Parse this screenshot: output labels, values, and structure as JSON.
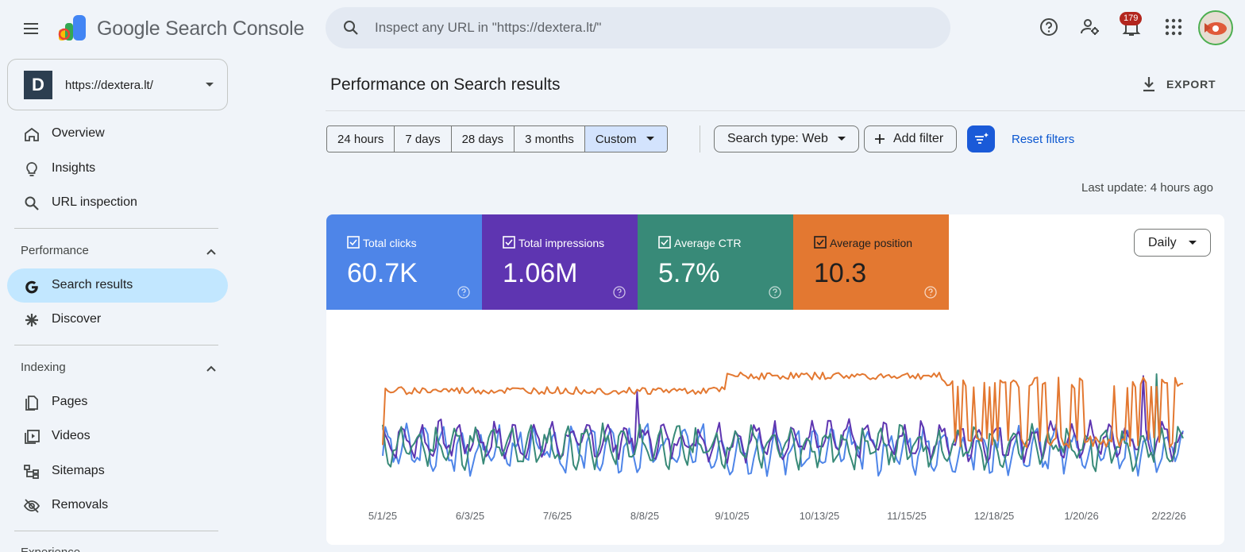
{
  "app": {
    "title": "Google Search Console",
    "notifications_count": "179"
  },
  "search": {
    "placeholder": "Inspect any URL in \"https://dextera.lt/\""
  },
  "property": {
    "logo_letter": "D",
    "name": "https://dextera.lt/"
  },
  "sidebar": {
    "top_items": [
      {
        "label": "Overview",
        "icon": "home-icon"
      },
      {
        "label": "Insights",
        "icon": "lightbulb-icon"
      },
      {
        "label": "URL inspection",
        "icon": "search-icon"
      }
    ],
    "performance": {
      "title": "Performance",
      "items": [
        {
          "label": "Search results",
          "icon": "google-g-icon",
          "active": true
        },
        {
          "label": "Discover",
          "icon": "asterisk-icon"
        }
      ]
    },
    "indexing": {
      "title": "Indexing",
      "items": [
        {
          "label": "Pages",
          "icon": "pages-icon"
        },
        {
          "label": "Videos",
          "icon": "video-icon"
        },
        {
          "label": "Sitemaps",
          "icon": "sitemap-icon"
        },
        {
          "label": "Removals",
          "icon": "eye-off-icon"
        }
      ]
    },
    "next_section_partial": "Experience"
  },
  "main": {
    "title": "Performance on Search results",
    "export_label": "EXPORT",
    "ranges": [
      "24 hours",
      "7 days",
      "28 days",
      "3 months",
      "Custom"
    ],
    "selected_range": "Custom",
    "search_type": "Search type: Web",
    "add_filter": "Add filter",
    "reset_filters": "Reset filters",
    "last_update": "Last update: 4 hours ago",
    "granularity": "Daily"
  },
  "metrics": [
    {
      "label": "Total clicks",
      "value": "60.7K",
      "color": "#4e85e8",
      "checked": true
    },
    {
      "label": "Total impressions",
      "value": "1.06M",
      "color": "#5e35b1",
      "checked": true
    },
    {
      "label": "Average CTR",
      "value": "5.7%",
      "color": "#388a78",
      "checked": true
    },
    {
      "label": "Average position",
      "value": "10.3",
      "color": "#e37831",
      "checked": true
    }
  ],
  "chart_data": {
    "type": "line",
    "x_tick_labels": [
      "5/1/25",
      "6/3/25",
      "7/6/25",
      "8/8/25",
      "9/10/25",
      "10/13/25",
      "11/15/25",
      "12/18/25",
      "1/20/26",
      "2/22/26"
    ],
    "x_range": [
      "5/1/25",
      "2/28/26"
    ],
    "y_axis_shown": false,
    "grid": false,
    "series": [
      {
        "name": "Total clicks",
        "color": "#4e85e8",
        "level": 0.32,
        "amp": 0.11,
        "seed": 3
      },
      {
        "name": "Total impressions",
        "color": "#5e35b1",
        "level": 0.38,
        "amp": 0.09,
        "seed": 7
      },
      {
        "name": "Average CTR",
        "color": "#388a78",
        "level": 0.34,
        "amp": 0.1,
        "seed": 11
      },
      {
        "name": "Average position",
        "color": "#e37831",
        "level": 0.72,
        "amp": 0.05,
        "seed": 19
      }
    ]
  }
}
